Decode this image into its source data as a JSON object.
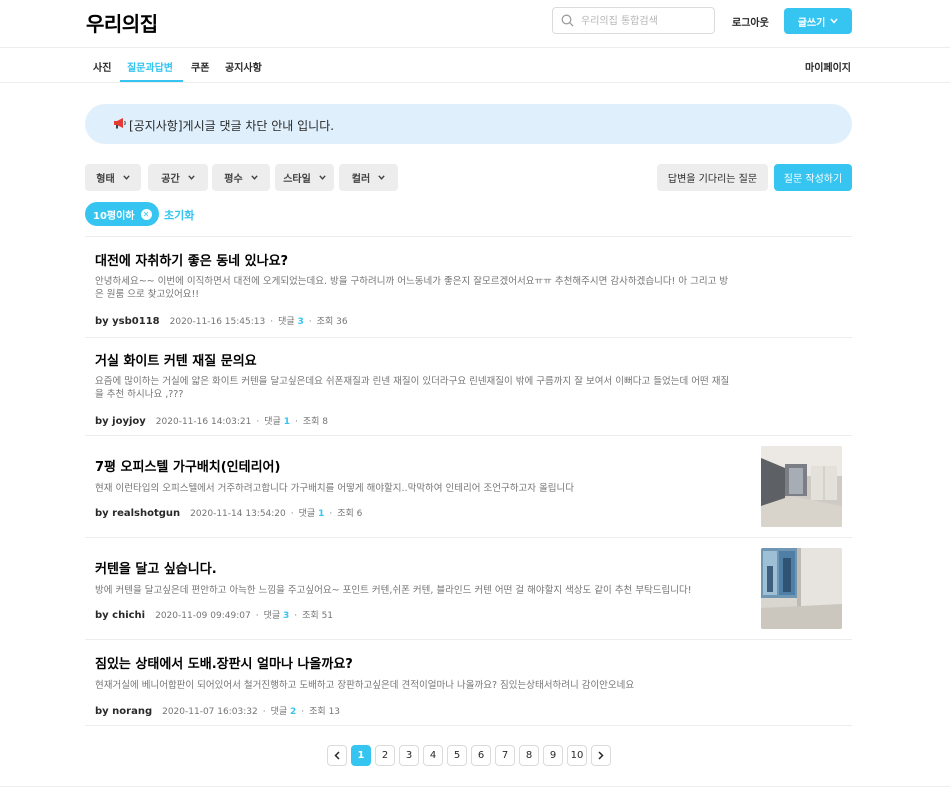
{
  "header": {
    "logo": "우리의집",
    "search_placeholder": "우리의집 통합검색",
    "logout": "로그아웃",
    "write_label": "글쓰기"
  },
  "nav": {
    "tabs": [
      {
        "label": "사진"
      },
      {
        "label": "질문과답변"
      },
      {
        "label": "쿠폰"
      },
      {
        "label": "공지사항"
      }
    ],
    "active_tab": "질문과답변",
    "mypage": "마이페이지"
  },
  "notice": {
    "text": "[공지사항]게시글 댓글 차단 안내 입니다."
  },
  "filters": {
    "items": [
      {
        "label": "형태"
      },
      {
        "label": "공간"
      },
      {
        "label": "평수"
      },
      {
        "label": "스타일"
      },
      {
        "label": "컬러"
      }
    ],
    "waiting_label": "답변을 기다리는 질문",
    "ask_label": "질문 작성하기"
  },
  "active_filter": {
    "chip": "10평이하",
    "reset": "초기화"
  },
  "posts": [
    {
      "title": "대전에 자취하기 좋은 동네 있나요?",
      "excerpt": "안녕하세요~~ 이번에 이직하면서 대전에 오게되었는데요. 방을 구하려니까 어느동네가 좋은지 잘모르겠어서요ㅠㅠ 추천해주시면 감사하겠습니다! 아 그리고 방은 원룸 으로 찾고있어요!!",
      "author": "by ysb0118",
      "date": "2020-11-16 15:45:13",
      "comment_label": "댓글",
      "comments": "3",
      "views": "조회 36",
      "has_image": false
    },
    {
      "title": "거실 화이트 커텐 재질 문의요",
      "excerpt": "요즘에 많이하는 거실에 얇은 화이트 커텐을 달고싶은데요 쉬폰재질과 린넨 재질이 있더라구요 린넨재질이 밖에 구름까지 잘 보여서 이뻐다고 들었는데 어떤 재질을 추천 하시나요 ,???",
      "author": "by joyjoy",
      "date": "2020-11-16 14:03:21",
      "comment_label": "댓글",
      "comments": "1",
      "views": "조회 8",
      "has_image": false
    },
    {
      "title": "7평 오피스텔 가구배치(인테리어)",
      "excerpt": "현재 이런타입의 오피스텔에서 거주하려고합니다 가구배치를 어떻게 해야할지..막막하여 인테리어 조언구하고자 올립니다",
      "author": "by realshotgun",
      "date": "2020-11-14 13:54:20",
      "comment_label": "댓글",
      "comments": "1",
      "views": "조회 6",
      "has_image": true
    },
    {
      "title": "커텐을 달고 싶습니다.",
      "excerpt": "방에 커텐을 달고싶은데 편안하고 아늑한 느낌을 주고싶어요~ 포인트 커텐,쉬폰 커텐, 블라인드 커텐 어떤 걸 해야할지 색상도 같이 추천 부탁드립니다!",
      "author": "by chichi",
      "date": "2020-11-09 09:49:07",
      "comment_label": "댓글",
      "comments": "3",
      "views": "조회 51",
      "has_image": true
    },
    {
      "title": "짐있는 상태에서 도배.장판시 얼마나 나올까요?",
      "excerpt": "현재거실에 베니어합판이 되어있어서 철거진행하고 도배하고 장판하고싶은데 견적이얼마나 나올까요? 짐있는상태서하려니 감이안오네요",
      "author": "by norang",
      "date": "2020-11-07 16:03:32",
      "comment_label": "댓글",
      "comments": "2",
      "views": "조회 13",
      "has_image": false
    }
  ],
  "pagination": {
    "pages": [
      "1",
      "2",
      "3",
      "4",
      "5",
      "6",
      "7",
      "8",
      "9",
      "10"
    ],
    "current": "1",
    "prev": "‹",
    "next": "›"
  },
  "colors": {
    "accent": "#35c5f0",
    "notice_bg": "#dfeffc",
    "filter_bg": "#ededed"
  }
}
